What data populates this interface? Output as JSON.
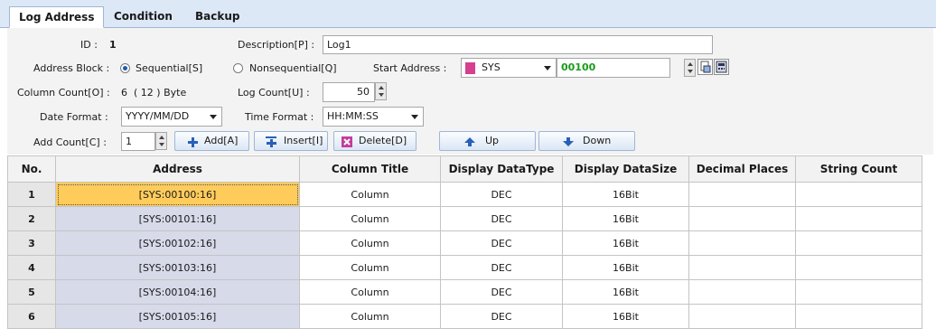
{
  "tabs": [
    "Log Address",
    "Condition",
    "Backup"
  ],
  "form": {
    "id_label": "ID :",
    "id_value": "1",
    "desc_label": "Description[P] :",
    "desc_value": "Log1",
    "addr_block_label": "Address Block :",
    "sequential_label": "Sequential[S]",
    "nonsequential_label": "Nonsequential[Q]",
    "start_addr_label": "Start Address :",
    "device": "SYS",
    "start_addr_value": "00100",
    "col_count_label": "Column Count[O] :",
    "col_count_value": "6",
    "col_bytes": "( 12 ) Byte",
    "log_count_label": "Log Count[U] :",
    "log_count_value": "50",
    "date_format_label": "Date Format :",
    "date_format_value": "YYYY/MM/DD",
    "time_format_label": "Time Format :",
    "time_format_value": "HH:MM:SS",
    "add_count_label": "Add Count[C] :",
    "add_count_value": "1"
  },
  "buttons": {
    "add": "Add[A]",
    "insert": "Insert[I]",
    "delete": "Delete[D]",
    "up": "Up",
    "down": "Down"
  },
  "colors": {
    "tab_bg": "#dde8f7",
    "selected_cell": "#ffcc5c",
    "address_cell": "#d6dae9",
    "start_addr_text": "#1a9a1a"
  },
  "table": {
    "columns": [
      "No.",
      "Address",
      "Column Title",
      "Display DataType",
      "Display DataSize",
      "Decimal Places",
      "String Count"
    ],
    "rows": [
      [
        "1",
        "[SYS:00100:16]",
        "Column",
        "DEC",
        "16Bit",
        "",
        ""
      ],
      [
        "2",
        "[SYS:00101:16]",
        "Column",
        "DEC",
        "16Bit",
        "",
        ""
      ],
      [
        "3",
        "[SYS:00102:16]",
        "Column",
        "DEC",
        "16Bit",
        "",
        ""
      ],
      [
        "4",
        "[SYS:00103:16]",
        "Column",
        "DEC",
        "16Bit",
        "",
        ""
      ],
      [
        "5",
        "[SYS:00104:16]",
        "Column",
        "DEC",
        "16Bit",
        "",
        ""
      ],
      [
        "6",
        "[SYS:00105:16]",
        "Column",
        "DEC",
        "16Bit",
        "",
        ""
      ]
    ]
  }
}
